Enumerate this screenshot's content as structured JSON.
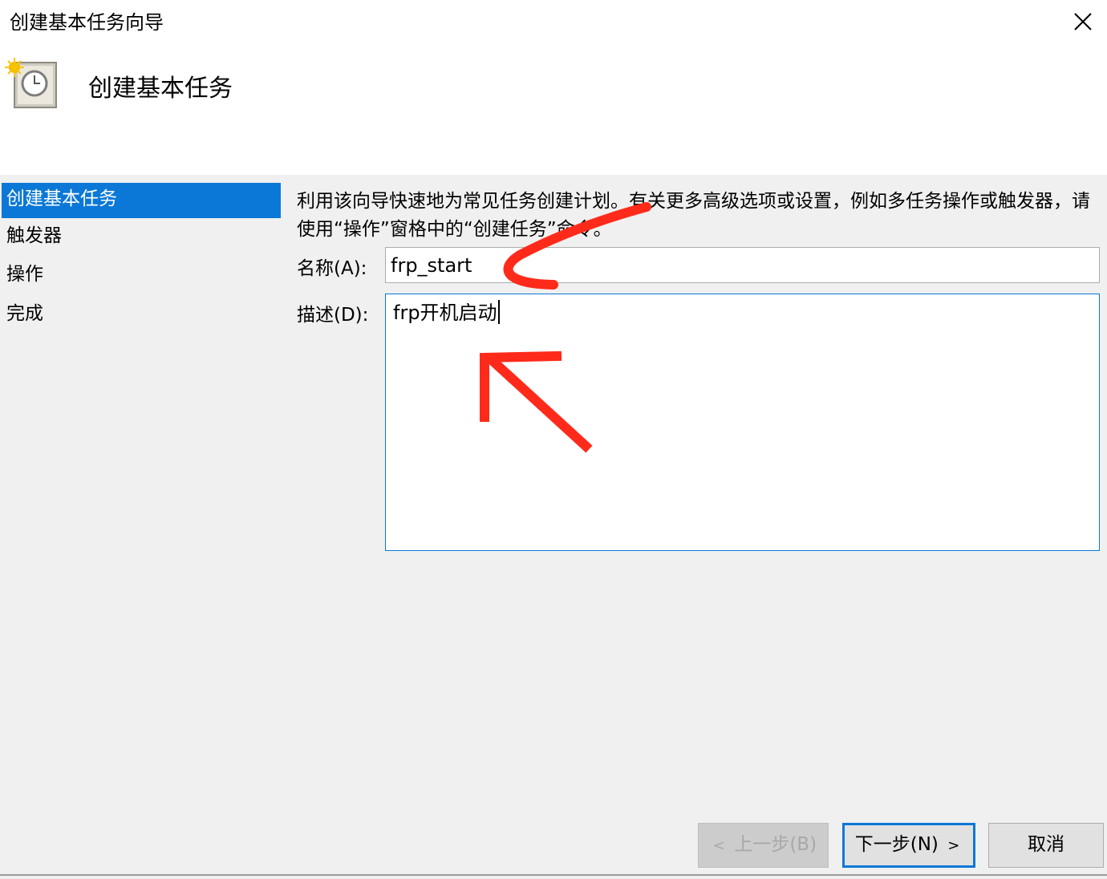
{
  "window": {
    "title": "创建基本任务向导",
    "close_glyph": "✕"
  },
  "wizard": {
    "heading": "创建基本任务",
    "icon": "scheduled-task-clock-icon"
  },
  "sidebar": {
    "items": [
      {
        "label": "创建基本任务",
        "active": true
      },
      {
        "label": "触发器",
        "active": false
      },
      {
        "label": "操作",
        "active": false
      },
      {
        "label": "完成",
        "active": false
      }
    ]
  },
  "main": {
    "description": "利用该向导快速地为常见任务创建计划。有关更多高级选项或设置，例如多任务操作或触发器，请使用“操作”窗格中的“创建任务”命令。",
    "name_label": "名称(A):",
    "name_value": "frp_start",
    "desc_label": "描述(D):",
    "desc_value": "frp开机启动"
  },
  "buttons": {
    "back_label": "上一步(B)",
    "back_prefix": "<",
    "next_label": "下一步(N)",
    "next_suffix": ">",
    "cancel_label": "取消"
  },
  "annotation": {
    "arrow_color": "#ff2a1a"
  }
}
